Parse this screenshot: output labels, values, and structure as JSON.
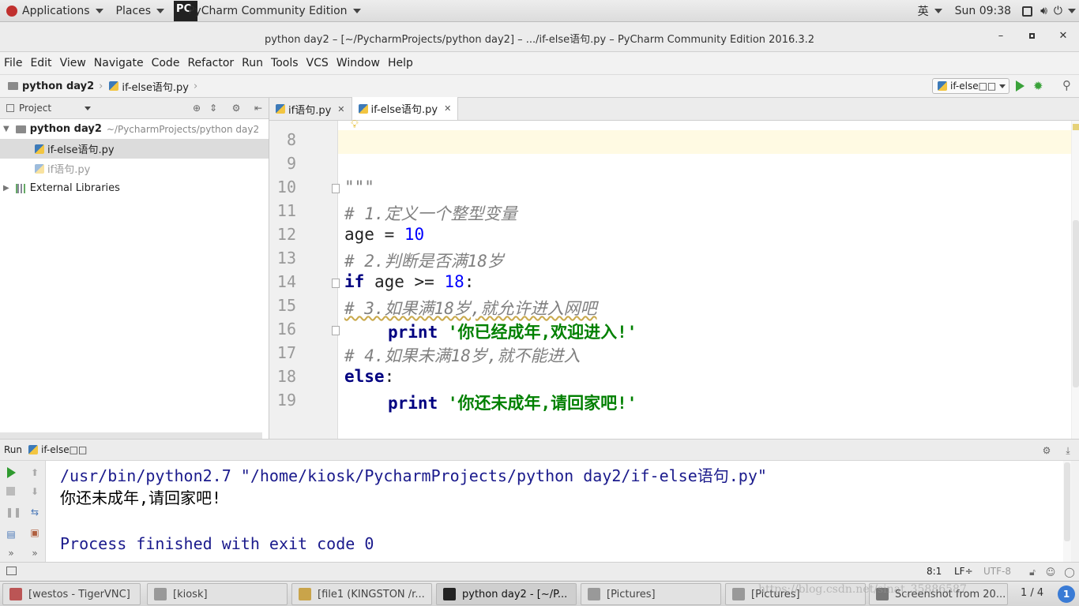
{
  "topbar": {
    "applications": "Applications",
    "places": "Places",
    "app_name": "PyCharm Community Edition",
    "input_method": "英",
    "clock": "Sun 09:38"
  },
  "window": {
    "title": "python day2 – [~/PycharmProjects/python day2] – .../if-else语句.py – PyCharm Community Edition 2016.3.2"
  },
  "menu": [
    "File",
    "Edit",
    "View",
    "Navigate",
    "Code",
    "Refactor",
    "Run",
    "Tools",
    "VCS",
    "Window",
    "Help"
  ],
  "breadcrumb": {
    "project": "python day2",
    "file": "if-else语句.py"
  },
  "run_config": {
    "label": "if-else□□"
  },
  "project_pane": {
    "header": "Project",
    "root": "python day2",
    "root_path": "~/PycharmProjects/python day2",
    "files": [
      "if-else语句.py",
      "if语句.py"
    ],
    "external": "External Libraries"
  },
  "tabs": [
    {
      "label": "if语句.py"
    },
    {
      "label": "if-else语句.py"
    }
  ],
  "editor": {
    "line_numbers": [
      "8",
      "9",
      "10",
      "11",
      "12",
      "13",
      "14",
      "15",
      "16",
      "17",
      "18",
      "19"
    ],
    "l10": "\"\"\"",
    "l11": "# 1.定义一个整型变量",
    "l12_var": "age",
    "l12_op": " = ",
    "l12_num": "10",
    "l13": "# 2.判断是否满18岁",
    "l14_kw": "if",
    "l14_mid": " age >= ",
    "l14_num": "18",
    "l14_end": ":",
    "l15": "# 3.如果满18岁,就允许进入网吧",
    "l16_kw": "print",
    "l16_str": "'你已经成年,欢迎进入!'",
    "l17": "# 4.如果未满18岁,就不能进入",
    "l18_kw": "else",
    "l18_end": ":",
    "l19_kw": "print",
    "l19_str": "'你还未成年,请回家吧!'"
  },
  "run_panel": {
    "label": "Run",
    "config": "if-else□□",
    "cmd": "/usr/bin/python2.7 \"/home/kiosk/PycharmProjects/python day2/if-else语句.py\"",
    "output": "你还未成年,请回家吧!",
    "exit": "Process finished with exit code 0"
  },
  "statusbar": {
    "position": "8:1",
    "line_sep": "LF÷",
    "encoding": "UTF-8"
  },
  "taskbar": {
    "items": [
      "[westos - TigerVNC]",
      "[kiosk]",
      "[file1 (KINGSTON /r...",
      "python day2 - [~/P...",
      "[Pictures]",
      "[Pictures]",
      "Screenshot from 20..."
    ],
    "workspace": "1 / 4",
    "badge": "1",
    "watermark": "https://blog.csdn.net/sinat_35886587"
  }
}
